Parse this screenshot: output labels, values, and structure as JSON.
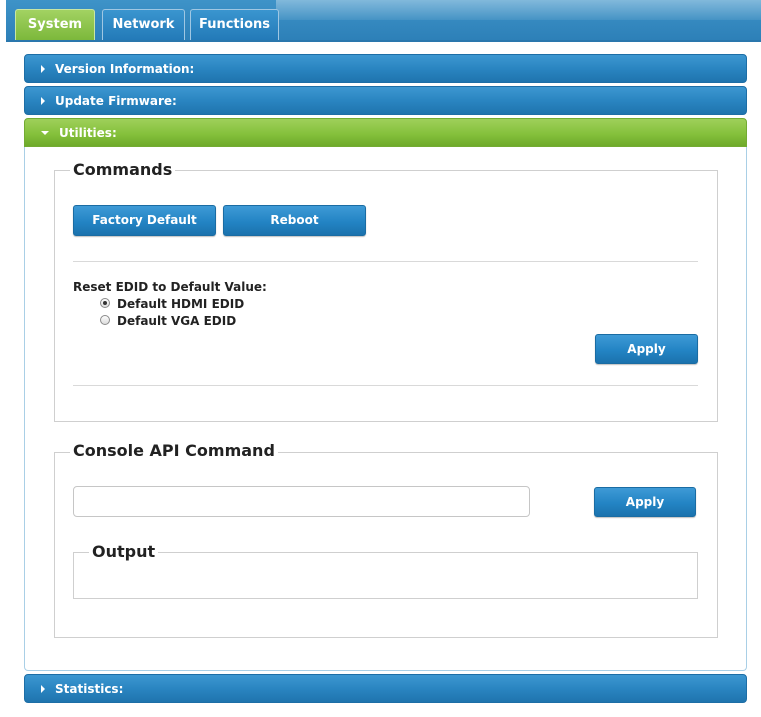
{
  "tabs": [
    {
      "label": "System",
      "active": true
    },
    {
      "label": "Network",
      "active": false
    },
    {
      "label": "Functions",
      "active": false
    }
  ],
  "sections": {
    "version": {
      "label": "Version Information:",
      "expanded": false
    },
    "firmware": {
      "label": "Update Firmware:",
      "expanded": false
    },
    "utilities": {
      "label": "Utilities:",
      "expanded": true
    },
    "statistics": {
      "label": "Statistics:",
      "expanded": false
    }
  },
  "commands": {
    "legend": "Commands",
    "factory_default_label": "Factory Default",
    "reboot_label": "Reboot",
    "edid_label": "Reset EDID to Default Value:",
    "edid_options": [
      {
        "label": "Default HDMI EDID",
        "selected": true
      },
      {
        "label": "Default VGA EDID",
        "selected": false
      }
    ],
    "apply_label": "Apply"
  },
  "console": {
    "legend": "Console API Command",
    "input_value": "",
    "input_placeholder": "",
    "apply_label": "Apply",
    "output_legend": "Output",
    "output_text": ""
  },
  "colors": {
    "tab_active": "#8cc53f",
    "header_blue": "#2a85c1",
    "header_green": "#85c13c"
  },
  "icons": {
    "collapsed": "triangle-right-icon",
    "expanded": "triangle-down-icon"
  }
}
